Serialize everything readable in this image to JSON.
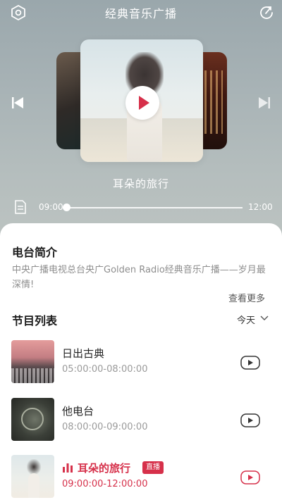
{
  "header": {
    "title": "经典音乐广播",
    "left_icon": "settings-hex-icon",
    "right_icon": "refresh-icon"
  },
  "player": {
    "now_playing_title": "耳朵的旅行",
    "time_start": "09:00",
    "time_end": "12:00",
    "progress": 0.0,
    "accent_color": "#d6304a"
  },
  "intro": {
    "heading": "电台简介",
    "text": "中央广播电视总台央广Golden Radio经典音乐广播——岁月最深情!",
    "more_label": "查看更多"
  },
  "program_list": {
    "heading": "节目列表",
    "day_label": "今天",
    "live_label": "直播",
    "items": [
      {
        "name": "日出古典",
        "hours": "05:00:00-08:00:00",
        "active": false
      },
      {
        "name": "他电台",
        "hours": "08:00:00-09:00:00",
        "active": false
      },
      {
        "name": "耳朵的旅行",
        "hours": "09:00:00-12:00:00",
        "active": true
      }
    ]
  }
}
